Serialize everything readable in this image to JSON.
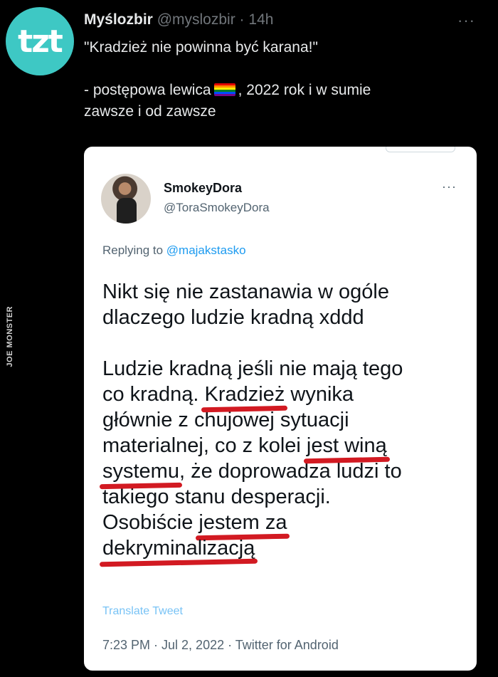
{
  "tweet": {
    "author_name": "Myślozbir",
    "author_handle": "@myslozbir",
    "separator": "·",
    "age": "14h",
    "more": "···",
    "avatar_logo": "tzt",
    "text_line1": "\"Kradzież nie powinna być karana!\"",
    "text_line2a": "- postępowa lewica",
    "text_line2b": ", 2022 rok i w sumie",
    "text_line3": "zawsze i od zawsze",
    "flag_icon": "rainbow-flag-emoji"
  },
  "watermark": "JOE MONSTER",
  "quoted": {
    "name": "SmokeyDora",
    "handle": "@ToraSmokeyDora",
    "more": "···",
    "replying_prefix": "Replying to ",
    "replying_handle": "@majakstasko",
    "p1_line1": "Nikt się nie zastanawia w ogóle",
    "p1_line2": "dlaczego ludzie kradną xddd",
    "l1": "Ludzie kradną jeśli nie mają tego",
    "l2_pre": "co kradną. ",
    "l2_ul": "Kradzież",
    "l2_post": " wynika",
    "l3": "głównie z chujowej sytuacji",
    "l4_pre": "materialnej, co z kolei ",
    "l4_ul": "jest winą",
    "l5_ul": "systemu",
    "l5_post": ", że doprowadza ludzi to",
    "l6": "takiego stanu desperacji.",
    "l7_pre": "Osobiście ",
    "l7_ul": "jestem za",
    "l8_ul": "dekryminalizacją",
    "translate": "Translate Tweet",
    "meta": "7:23 PM · Jul 2, 2022 · Twitter for Android"
  },
  "colors": {
    "background": "#000000",
    "card": "#ffffff",
    "link": "#1d9bf0",
    "underline_marker": "#d21a22",
    "avatar": "#3ec8c4"
  }
}
